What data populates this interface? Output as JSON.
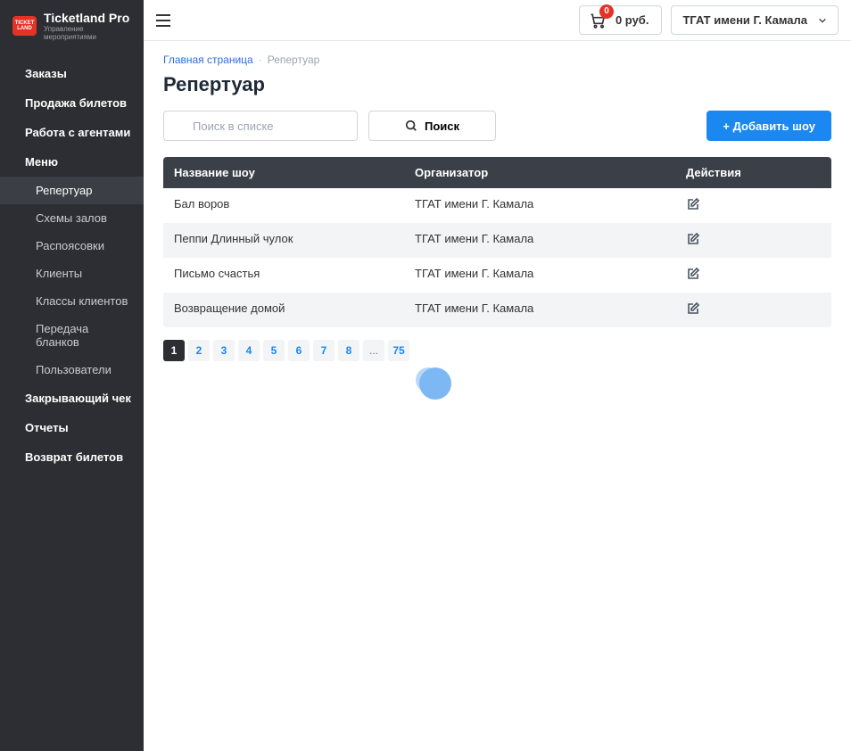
{
  "logo": {
    "badge_line1": "TICKET",
    "badge_line2": "LAND",
    "title": "Ticketland Pro",
    "subtitle": "Управление мероприятиями"
  },
  "sidebar": {
    "items": [
      {
        "label": "Заказы",
        "sub": false
      },
      {
        "label": "Продажа билетов",
        "sub": false
      },
      {
        "label": "Работа с агентами",
        "sub": false
      },
      {
        "label": "Меню",
        "sub": false
      },
      {
        "label": "Репертуар",
        "sub": true,
        "active": true
      },
      {
        "label": "Схемы залов",
        "sub": true
      },
      {
        "label": "Распоясовки",
        "sub": true
      },
      {
        "label": "Клиенты",
        "sub": true
      },
      {
        "label": "Классы клиентов",
        "sub": true
      },
      {
        "label": "Передача бланков",
        "sub": true
      },
      {
        "label": "Пользователи",
        "sub": true
      },
      {
        "label": "Закрывающий чек",
        "sub": false
      },
      {
        "label": "Отчеты",
        "sub": false
      },
      {
        "label": "Возврат билетов",
        "sub": false
      }
    ]
  },
  "topbar": {
    "cart_count": "0",
    "cart_amount": "0 руб.",
    "venue": "ТГАТ имени Г. Камала"
  },
  "breadcrumb": {
    "home": "Главная страница",
    "current": "Репертуар"
  },
  "page_title": "Репертуар",
  "search": {
    "placeholder": "Поиск в списке",
    "button": "Поиск"
  },
  "add_button": "+ Добавить шоу",
  "table": {
    "headers": {
      "name": "Название шоу",
      "org": "Организатор",
      "actions": "Действия"
    },
    "rows": [
      {
        "name": "Бал воров",
        "org": "ТГАТ имени Г. Камала"
      },
      {
        "name": "Пеппи Длинный чулок",
        "org": "ТГАТ имени Г. Камала"
      },
      {
        "name": "Письмо счастья",
        "org": "ТГАТ имени Г. Камала"
      },
      {
        "name": "Возвращение домой",
        "org": "ТГАТ имени Г. Камала"
      }
    ]
  },
  "pagination": {
    "pages": [
      "1",
      "2",
      "3",
      "4",
      "5",
      "6",
      "7",
      "8"
    ],
    "ellipsis": "...",
    "last": "75",
    "active": "1"
  }
}
